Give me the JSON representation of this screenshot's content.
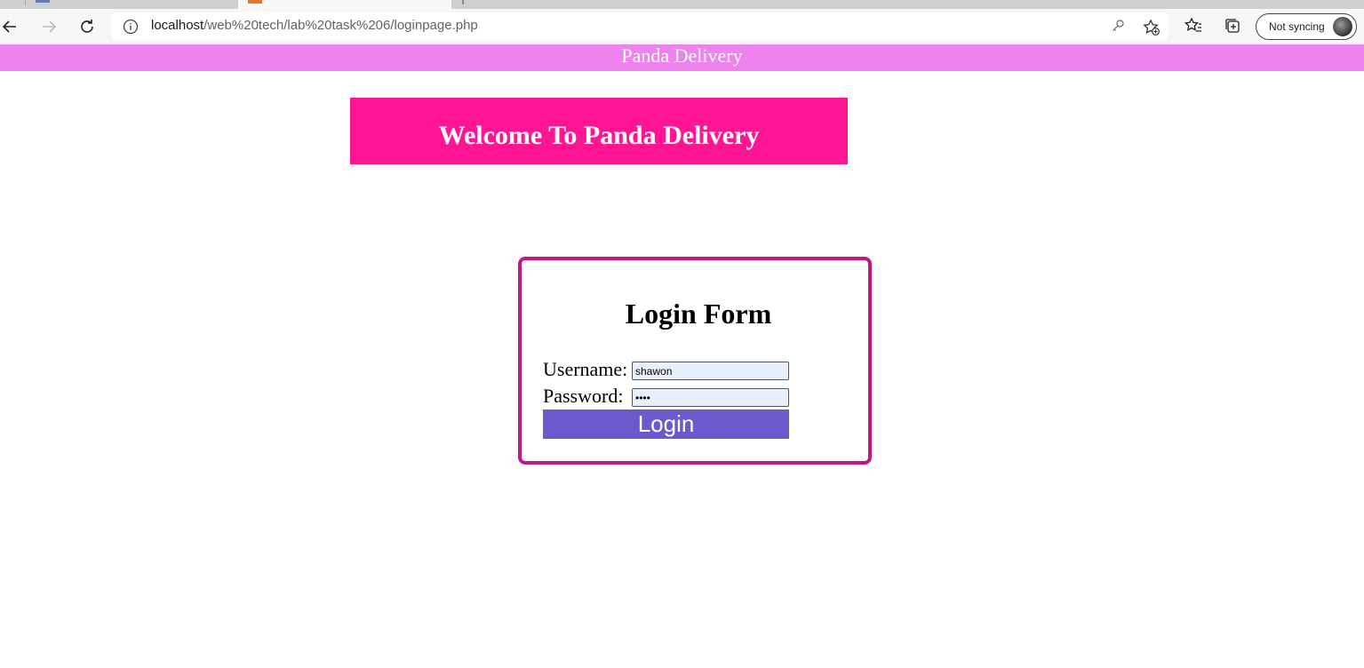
{
  "browser": {
    "url_host": "localhost",
    "url_path": "/web%20tech/lab%20task%206/loginpage.php",
    "sync_label": "Not syncing"
  },
  "page": {
    "banner_text": "Panda Delivery",
    "welcome_heading": "Welcome To Panda Delivery",
    "login_form": {
      "title": "Login Form",
      "username_label": "Username:",
      "username_value": "shawon",
      "password_label": "Password:",
      "password_value": "••••",
      "submit_label": "Login"
    }
  },
  "colors": {
    "banner_bg": "#ee82ee",
    "welcome_bg": "#ff1493",
    "form_border": "#c71585",
    "button_bg": "#6a5acd",
    "input_bg": "#e8f0fe"
  }
}
